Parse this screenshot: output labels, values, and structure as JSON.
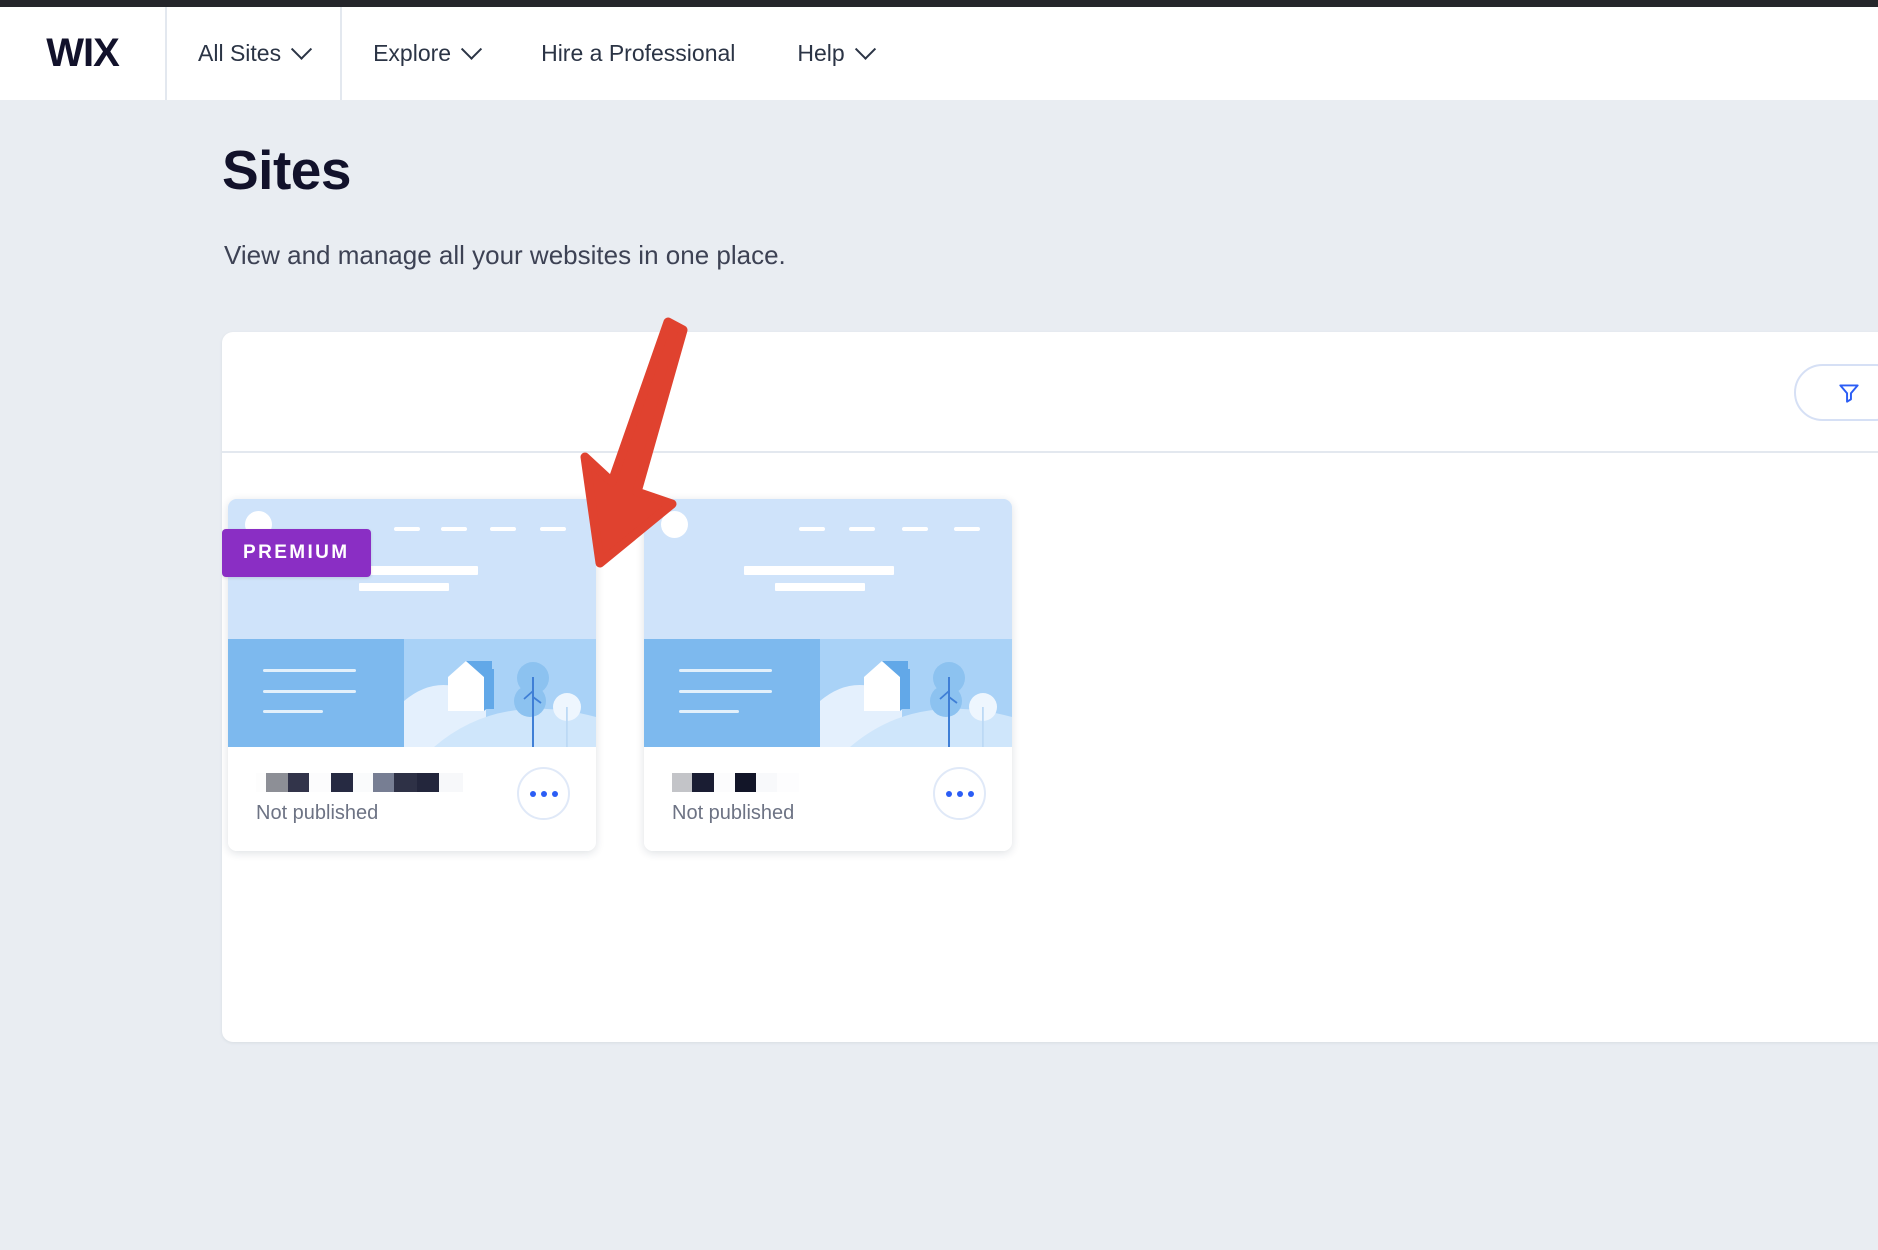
{
  "header": {
    "logo_text": "WIX",
    "nav": [
      {
        "label": "All Sites",
        "has_chevron": true,
        "divider_right": true
      },
      {
        "label": "Explore",
        "has_chevron": true,
        "divider_right": false
      },
      {
        "label": "Hire a Professional",
        "has_chevron": false,
        "divider_right": false
      },
      {
        "label": "Help",
        "has_chevron": true,
        "divider_right": false
      }
    ]
  },
  "page": {
    "title": "Sites",
    "subtitle": "View and manage all your websites in one place."
  },
  "toolbar": {
    "filter_icon": "filter-funnel-icon",
    "filter_accent": "#2b5df5"
  },
  "sites": [
    {
      "badge": "PREMIUM",
      "badge_color": "#8a2ec4",
      "status": "Not published",
      "name_redacted": true,
      "more_icon": "more-options-icon",
      "thumbnail": {
        "logo_circle": true,
        "nav_dashes": 4,
        "headline_bar": true,
        "sub_bar": true
      }
    },
    {
      "badge": null,
      "status": "Not published",
      "name_redacted": true,
      "more_icon": "more-options-icon",
      "thumbnail": {
        "logo_circle": true,
        "nav_dashes": 4,
        "headline_bar": true,
        "sub_bar": true
      }
    }
  ],
  "annotation": {
    "type": "arrow",
    "color": "#e0422f",
    "points_to": "premium-site-card"
  },
  "colors": {
    "page_bg": "#e9edf2",
    "panel_bg": "#ffffff",
    "text_dark": "#12122b",
    "text_muted": "#6d7384",
    "thumb_sky": "#cfe3fa",
    "thumb_panel": "#7db9ee",
    "thumb_scene": "#a9d2f7"
  }
}
